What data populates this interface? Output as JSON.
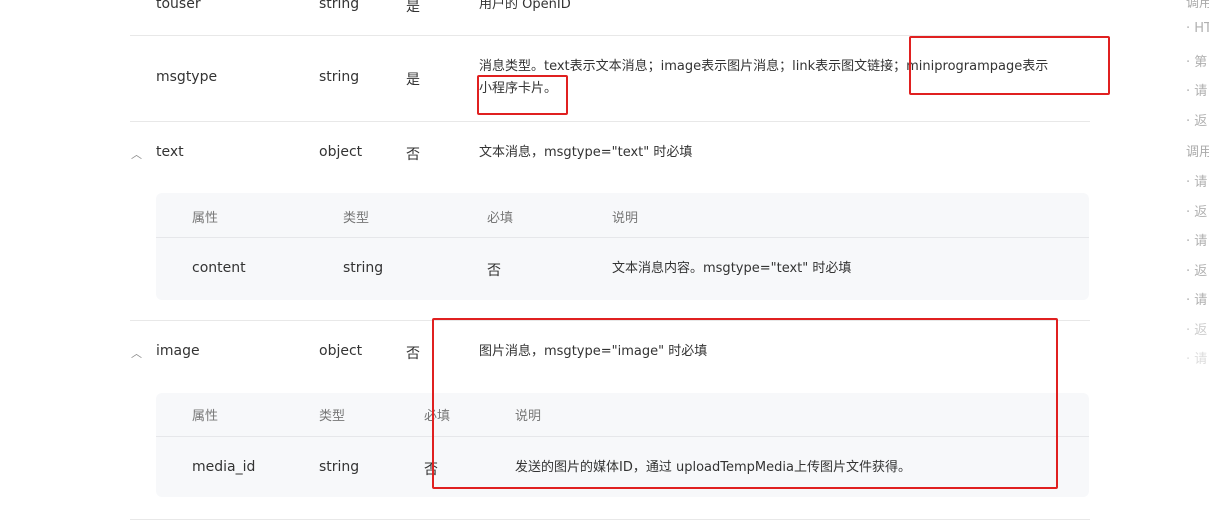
{
  "rows": {
    "touser": {
      "name": "touser",
      "type": "string",
      "required": "是",
      "desc": "用户的 OpenID"
    },
    "msgtype": {
      "name": "msgtype",
      "type": "string",
      "required": "是",
      "desc_line1": "消息类型。text表示文本消息；image表示图片消息；link表示图文链接；miniprogrampage表示",
      "desc_line2": "小程序卡片。"
    },
    "text": {
      "name": "text",
      "type": "object",
      "required": "否",
      "desc": "文本消息，msgtype=\"text\" 时必填"
    },
    "image": {
      "name": "image",
      "type": "object",
      "required": "否",
      "desc": "图片消息，msgtype=\"image\" 时必填"
    }
  },
  "subtable_headers": {
    "attr": "属性",
    "type": "类型",
    "required": "必填",
    "desc": "说明"
  },
  "text_sub": {
    "name": "content",
    "type": "string",
    "required": "否",
    "desc": "文本消息内容。msgtype=\"text\" 时必填"
  },
  "image_sub": {
    "name": "media_id",
    "type": "string",
    "required": "否",
    "desc": "发送的图片的媒体ID，通过 uploadTempMedia上传图片文件获得。"
  },
  "toc": [
    {
      "label": "调用"
    },
    {
      "label": "· HT"
    },
    {
      "label": "· 第"
    },
    {
      "label": "· 请"
    },
    {
      "label": "· 返"
    },
    {
      "label": "调用"
    },
    {
      "label": "· 请"
    },
    {
      "label": "· 返"
    },
    {
      "label": "· 请"
    },
    {
      "label": "· 返"
    },
    {
      "label": "· 请"
    },
    {
      "label": "· 返"
    },
    {
      "label": "· 请"
    }
  ],
  "icons": {
    "expand": "chevron-up-icon"
  },
  "colors": {
    "annotation": "#e02020",
    "subtable_bg": "#f7f8fa",
    "divider": "#e8e8e8"
  }
}
